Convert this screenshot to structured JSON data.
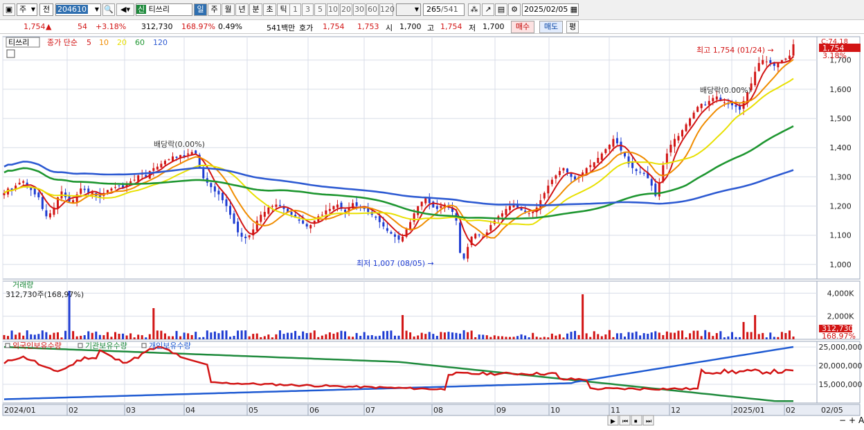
{
  "toolbar": {
    "market": "주",
    "prev": "전",
    "code": "204610",
    "stock_tag": "신",
    "stock_name": "티쓰리",
    "periods": [
      "일",
      "주",
      "월",
      "년",
      "분",
      "초",
      "틱"
    ],
    "active_period": "일",
    "nums": [
      "1",
      "3",
      "5",
      "10",
      "20",
      "30",
      "60",
      "120"
    ],
    "count": "265",
    "total": "/541",
    "date": "2025/02/05"
  },
  "quote": {
    "price": "1,754",
    "arrow": "▲",
    "change": "54",
    "pct": "+3.18%",
    "volume": "312,730",
    "vol_ratio": "168.97%",
    "turnover": "0.49%",
    "amount": "541백만",
    "hoga_label": "호가",
    "ask": "1,754",
    "bid": "1,753",
    "open_label": "시",
    "open": "1,700",
    "high_label": "고",
    "high": "1,754",
    "low_label": "저",
    "low": "1,700",
    "buy": "매수",
    "sell": "매도",
    "eval": "평"
  },
  "price_panel": {
    "name_tag": "티쓰리",
    "legend_prefix": "종가 단순",
    "ma": [
      {
        "label": "5",
        "color": "#d21414"
      },
      {
        "label": "10",
        "color": "#f08c00"
      },
      {
        "label": "20",
        "color": "#e8e000"
      },
      {
        "label": "60",
        "color": "#1e9630"
      },
      {
        "label": "120",
        "color": "#2d5ad2"
      }
    ],
    "yticks": [
      "1,000",
      "1,100",
      "1,200",
      "1,300",
      "1,400",
      "1,500",
      "1,600",
      "1,700"
    ],
    "ymin": 950,
    "ymax": 1780,
    "top_right_label": "C:74.18",
    "last_price_tag": "1,754",
    "last_pct_tag": "3.18%",
    "annotations": {
      "high": "최고 1,754 (01/24)",
      "low": "최저 1,007 (08/05)",
      "div1": "배당락(0.00%)",
      "div2": "배당락(0.00%)"
    }
  },
  "volume_panel": {
    "title": "거래량",
    "value_label": "312,730주(168,97%)",
    "yticks": [
      "2,000K",
      "4,000K"
    ],
    "ymax": 4800000,
    "last_tag": "312,730",
    "last_pct": "168.97%"
  },
  "holding_panel": {
    "legend": [
      "외국인보유수량",
      "기관보유수량",
      "개인보유수량"
    ],
    "yticks": [
      "15,000,000",
      "20,000,000",
      "25,000,000"
    ]
  },
  "xaxis": {
    "labels": [
      "2024/01",
      "02",
      "03",
      "04",
      "05",
      "06",
      "07",
      "08",
      "09",
      "10",
      "11",
      "12",
      "2025/01",
      "02"
    ],
    "right_date": "02/05"
  },
  "chart_data": {
    "type": "candlestick",
    "dates": [
      "2024/01/02",
      "2025/02/05"
    ],
    "closes": [
      1245,
      1260,
      1255,
      1270,
      1280,
      1285,
      1270,
      1255,
      1240,
      1230,
      1190,
      1165,
      1175,
      1195,
      1230,
      1250,
      1230,
      1215,
      1220,
      1240,
      1260,
      1255,
      1245,
      1250,
      1235,
      1230,
      1245,
      1255,
      1260,
      1265,
      1270,
      1260,
      1275,
      1285,
      1290,
      1305,
      1310,
      1300,
      1320,
      1330,
      1335,
      1345,
      1355,
      1360,
      1370,
      1365,
      1375,
      1370,
      1380,
      1385,
      1380,
      1330,
      1295,
      1280,
      1265,
      1250,
      1240,
      1220,
      1200,
      1170,
      1140,
      1110,
      1095,
      1090,
      1100,
      1120,
      1150,
      1170,
      1180,
      1195,
      1200,
      1205,
      1200,
      1190,
      1180,
      1170,
      1160,
      1150,
      1140,
      1130,
      1135,
      1150,
      1165,
      1170,
      1185,
      1190,
      1200,
      1205,
      1190,
      1180,
      1195,
      1210,
      1200,
      1195,
      1190,
      1180,
      1170,
      1160,
      1145,
      1130,
      1115,
      1105,
      1095,
      1085,
      1095,
      1120,
      1145,
      1175,
      1200,
      1215,
      1230,
      1210,
      1195,
      1190,
      1200,
      1205,
      1195,
      1180,
      1150,
      1040,
      1020,
      1060,
      1095,
      1105,
      1100,
      1095,
      1110,
      1135,
      1150,
      1165,
      1175,
      1190,
      1200,
      1205,
      1195,
      1185,
      1180,
      1175,
      1180,
      1195,
      1220,
      1245,
      1270,
      1290,
      1305,
      1320,
      1330,
      1315,
      1300,
      1290,
      1300,
      1315,
      1330,
      1340,
      1350,
      1365,
      1380,
      1395,
      1410,
      1430,
      1415,
      1390,
      1370,
      1345,
      1330,
      1320,
      1315,
      1310,
      1295,
      1270,
      1235,
      1280,
      1340,
      1380,
      1410,
      1430,
      1440,
      1460,
      1480,
      1500,
      1520,
      1540,
      1550,
      1545,
      1560,
      1570,
      1575,
      1560,
      1555,
      1550,
      1545,
      1540,
      1530,
      1560,
      1590,
      1620,
      1660,
      1690,
      1700,
      1695,
      1690,
      1680,
      1690,
      1700,
      1705,
      1715,
      1754
    ]
  }
}
